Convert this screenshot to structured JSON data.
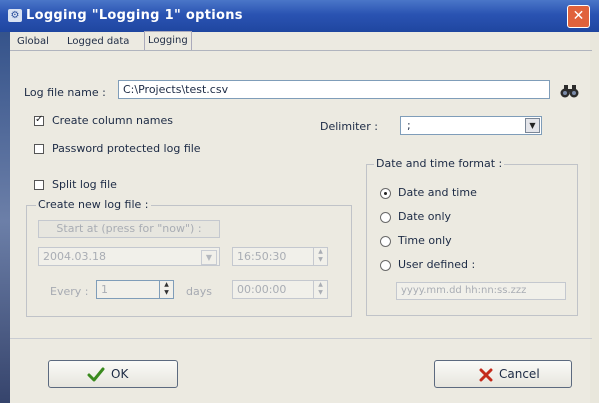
{
  "window": {
    "title": "Logging \"Logging 1\" options",
    "close_glyph": "✕"
  },
  "tabs": [
    {
      "label": "Global"
    },
    {
      "label": "Logged data"
    },
    {
      "label": "Logging",
      "active": true
    }
  ],
  "log_file": {
    "label": "Log file name :",
    "value": "C:\\Projects\\test.csv"
  },
  "create_column_names": {
    "label": "Create column names",
    "checked": true
  },
  "delimiter": {
    "label": "Delimiter :",
    "value": ";"
  },
  "password_protected": {
    "label": "Password protected log file",
    "checked": false
  },
  "split_log_file": {
    "label": "Split log file",
    "checked": false
  },
  "create_new_log_file": {
    "label": "Create new log file :",
    "start_button": "Start at (press for \"now\") :",
    "date": "2004.03.18",
    "time": "16:50:30",
    "every_label": "Every :",
    "every_value": "1",
    "days_label": "days",
    "interval": "00:00:00"
  },
  "date_time_format": {
    "label": "Date and time format :",
    "options": [
      {
        "label": "Date and time",
        "selected": true
      },
      {
        "label": "Date only",
        "selected": false
      },
      {
        "label": "Time only",
        "selected": false
      },
      {
        "label": "User defined :",
        "selected": false
      }
    ],
    "user_defined_pattern": "yyyy.mm.dd hh:nn:ss.zzz"
  },
  "buttons": {
    "ok": "OK",
    "cancel": "Cancel"
  },
  "colors": {
    "titlebar": "#2a53b2",
    "ok_check": "#3a8a1e",
    "cancel_x": "#c42a1a"
  },
  "icons": {
    "browse": "binoculars-icon",
    "ok": "checkmark-icon",
    "cancel": "x-icon"
  }
}
